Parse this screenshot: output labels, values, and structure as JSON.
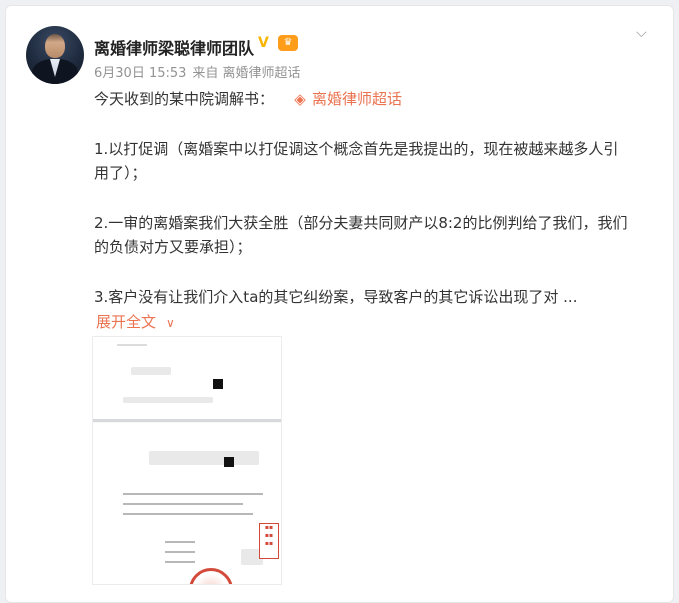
{
  "post": {
    "author": "离婚律师梁聪律师团队",
    "verified_icon": "verified-v-icon",
    "member_icon": "member-crown-icon",
    "time": "6月30日 15:53",
    "source_label": "来自",
    "source": "离婚律师超话",
    "menu_icon": "chevron-down-icon",
    "text": {
      "intro": "今天收到的某中院调解书：",
      "topic": "离婚律师超话",
      "p1_line1": "1.以打促调（离婚案中以打促调这个概念首先是我提出的，现在被越来越多人引",
      "p1_line2": "用了）；",
      "p2_line1": "2.一审的离婚案我们大获全胜（部分夫妻共同财产以8:2的比例判给了我们，我们",
      "p2_line2": "的负债对方又要承担）；",
      "p3_line1": "3.客户没有让我们介入ta的其它纠纷案，导致客户的其它诉讼出现了对 ..."
    },
    "expand_label": "展开全文",
    "accent_color": "#eb7350"
  }
}
